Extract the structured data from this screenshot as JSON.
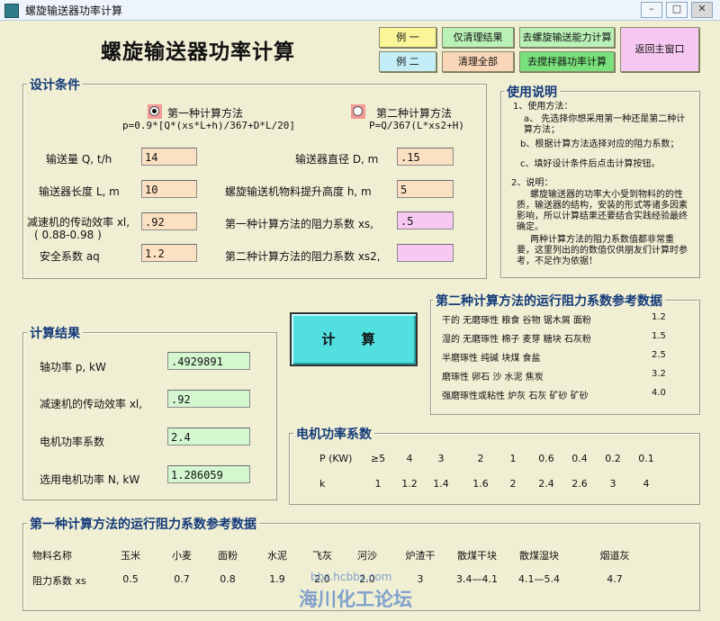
{
  "window": {
    "title": "螺旋输送器功率计算",
    "minimize": "–",
    "maximize": "□",
    "close": "✕"
  },
  "main_title": "螺旋输送器功率计算",
  "toolbar": {
    "example1": "例  一",
    "example2": "例  二",
    "clear_results": "仅清理结果",
    "clear_all": "清理全部",
    "to_capacity": "去螺旋输送能力计算",
    "to_mixer": "去搅拌器功率计算",
    "back_main": "返回主窗口"
  },
  "conditions": {
    "legend": "设计条件",
    "method1_label": "第一种计算方法",
    "method1_formula": "p=0.9*[Q*(xs*L+h)/367+D*L/20]",
    "method2_label": "第二种计算方法",
    "method2_formula": "P=Q/367(L*xs2+H)",
    "selected_method": 1,
    "q_label": "输送量 Q, t/h",
    "q_value": "14",
    "l_label": "输送器长度 L, m",
    "l_value": "10",
    "eff_label": "减速机的传动效率 xl,",
    "eff_range": "( 0.88-0.98 )",
    "eff_value": ".92",
    "aq_label": "安全系数 aq",
    "aq_value": "1.2",
    "d_label": "输送器直径 D, m",
    "d_value": ".15",
    "h_label": "螺旋输送机物料提升高度 h, m",
    "h_value": "5",
    "xs_label": "第一种计算方法的阻力系数 xs,",
    "xs_value": ".5",
    "xs2_label": "第二种计算方法的阻力系数 xs2,",
    "xs2_value": ""
  },
  "help": {
    "legend": "使用说明",
    "lines": [
      "1、使用方法：",
      "a、  先选择你想采用第一种还是第二种计算方法；",
      "b、根据计算方法选择对应的阻力系数；",
      "c、填好设计条件后点击计算按钮。",
      "2、说明：",
      "螺旋输送器的功率大小受到物料的的性质，输送器的结构，安装的形式等诸多因素影响，所以计算结果还要结合实践经验最终确定。",
      "两种计算方法的阻力系数值都非常重要，这里列出的的数值仅供朋友们计算时参考，不足作为依据！"
    ]
  },
  "ref2": {
    "legend": "第二种计算方法的运行阻力系数参考数据",
    "rows": [
      {
        "text": "干的 无磨琢性 粮食 谷物 锯木屑  面粉",
        "value": "1.2"
      },
      {
        "text": "湿的 无磨琢性 棉子 麦芽 糖块 石灰粉",
        "value": "1.5"
      },
      {
        "text": "半磨琢性 纯碱 块煤  食盐",
        "value": "2.5"
      },
      {
        "text": "磨琢性 卵石 沙 水泥 焦炭",
        "value": "3.2"
      },
      {
        "text": "强磨琢性或粘性 炉灰 石灰 矿砂 矿砂",
        "value": "4.0"
      }
    ]
  },
  "calc_button": "计  算",
  "results": {
    "legend": "计算结果",
    "shaft_label": "轴功率 p, kW",
    "shaft_value": ".4929891",
    "eff_label": "减速机的传动效率 xl,",
    "eff_value": ".92",
    "factor_label": "电机功率系数",
    "factor_value": "2.4",
    "motor_label": "选用电机功率 N, kW",
    "motor_value": "1.286059"
  },
  "motor_factor": {
    "legend": "电机功率系数",
    "p_header": "P (KW)",
    "p_values": [
      "≥5",
      "4",
      "3",
      "2",
      "1",
      "0.6",
      "0.4",
      "0.2",
      "0.1"
    ],
    "k_header": "k",
    "k_values": [
      "1",
      "1.2",
      "1.4",
      "1.6",
      "2",
      "2.4",
      "2.6",
      "3",
      "4"
    ]
  },
  "ref1": {
    "legend": "第一种计算方法的运行阻力系数参考数据",
    "name_header": "物料名称",
    "xs_header": "阻力系数 xs",
    "materials": [
      "玉米",
      "小麦",
      "面粉",
      "水泥",
      "飞灰",
      "河沙",
      "炉渣干",
      "散煤干块",
      "散煤湿块",
      "烟道灰"
    ],
    "values": [
      "0.5",
      "0.7",
      "0.8",
      "1.9",
      "2.0",
      "2.0",
      "3",
      "3.4—4.1",
      "4.1—5.4",
      "4.7"
    ]
  },
  "watermark": {
    "url": "bbs.hcbbs.com",
    "name": "海川化工论坛"
  }
}
